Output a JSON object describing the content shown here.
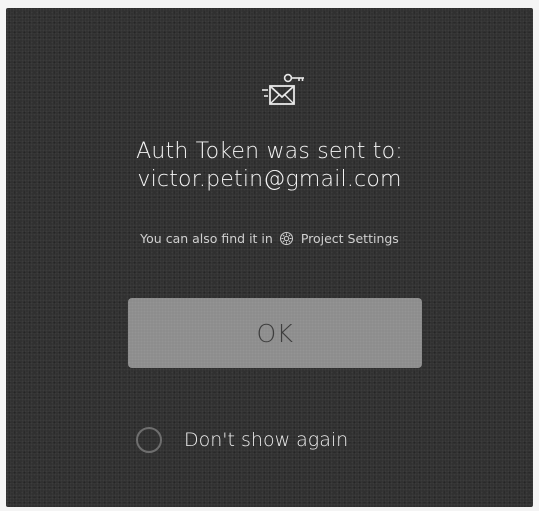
{
  "dialog": {
    "icon": "mail-key-icon",
    "title_line1": "Auth Token was sent to:",
    "title_line2": "victor.petin@gmail.com",
    "hint_prefix": "You can also find it in",
    "hint_icon": "gear-icon",
    "hint_link": "Project Settings",
    "ok_label": "OK",
    "dont_show_label": "Don't show again",
    "dont_show_checked": false
  },
  "colors": {
    "background": "#313131",
    "button": "#8d8d8d",
    "text": "#f2f2f2"
  }
}
